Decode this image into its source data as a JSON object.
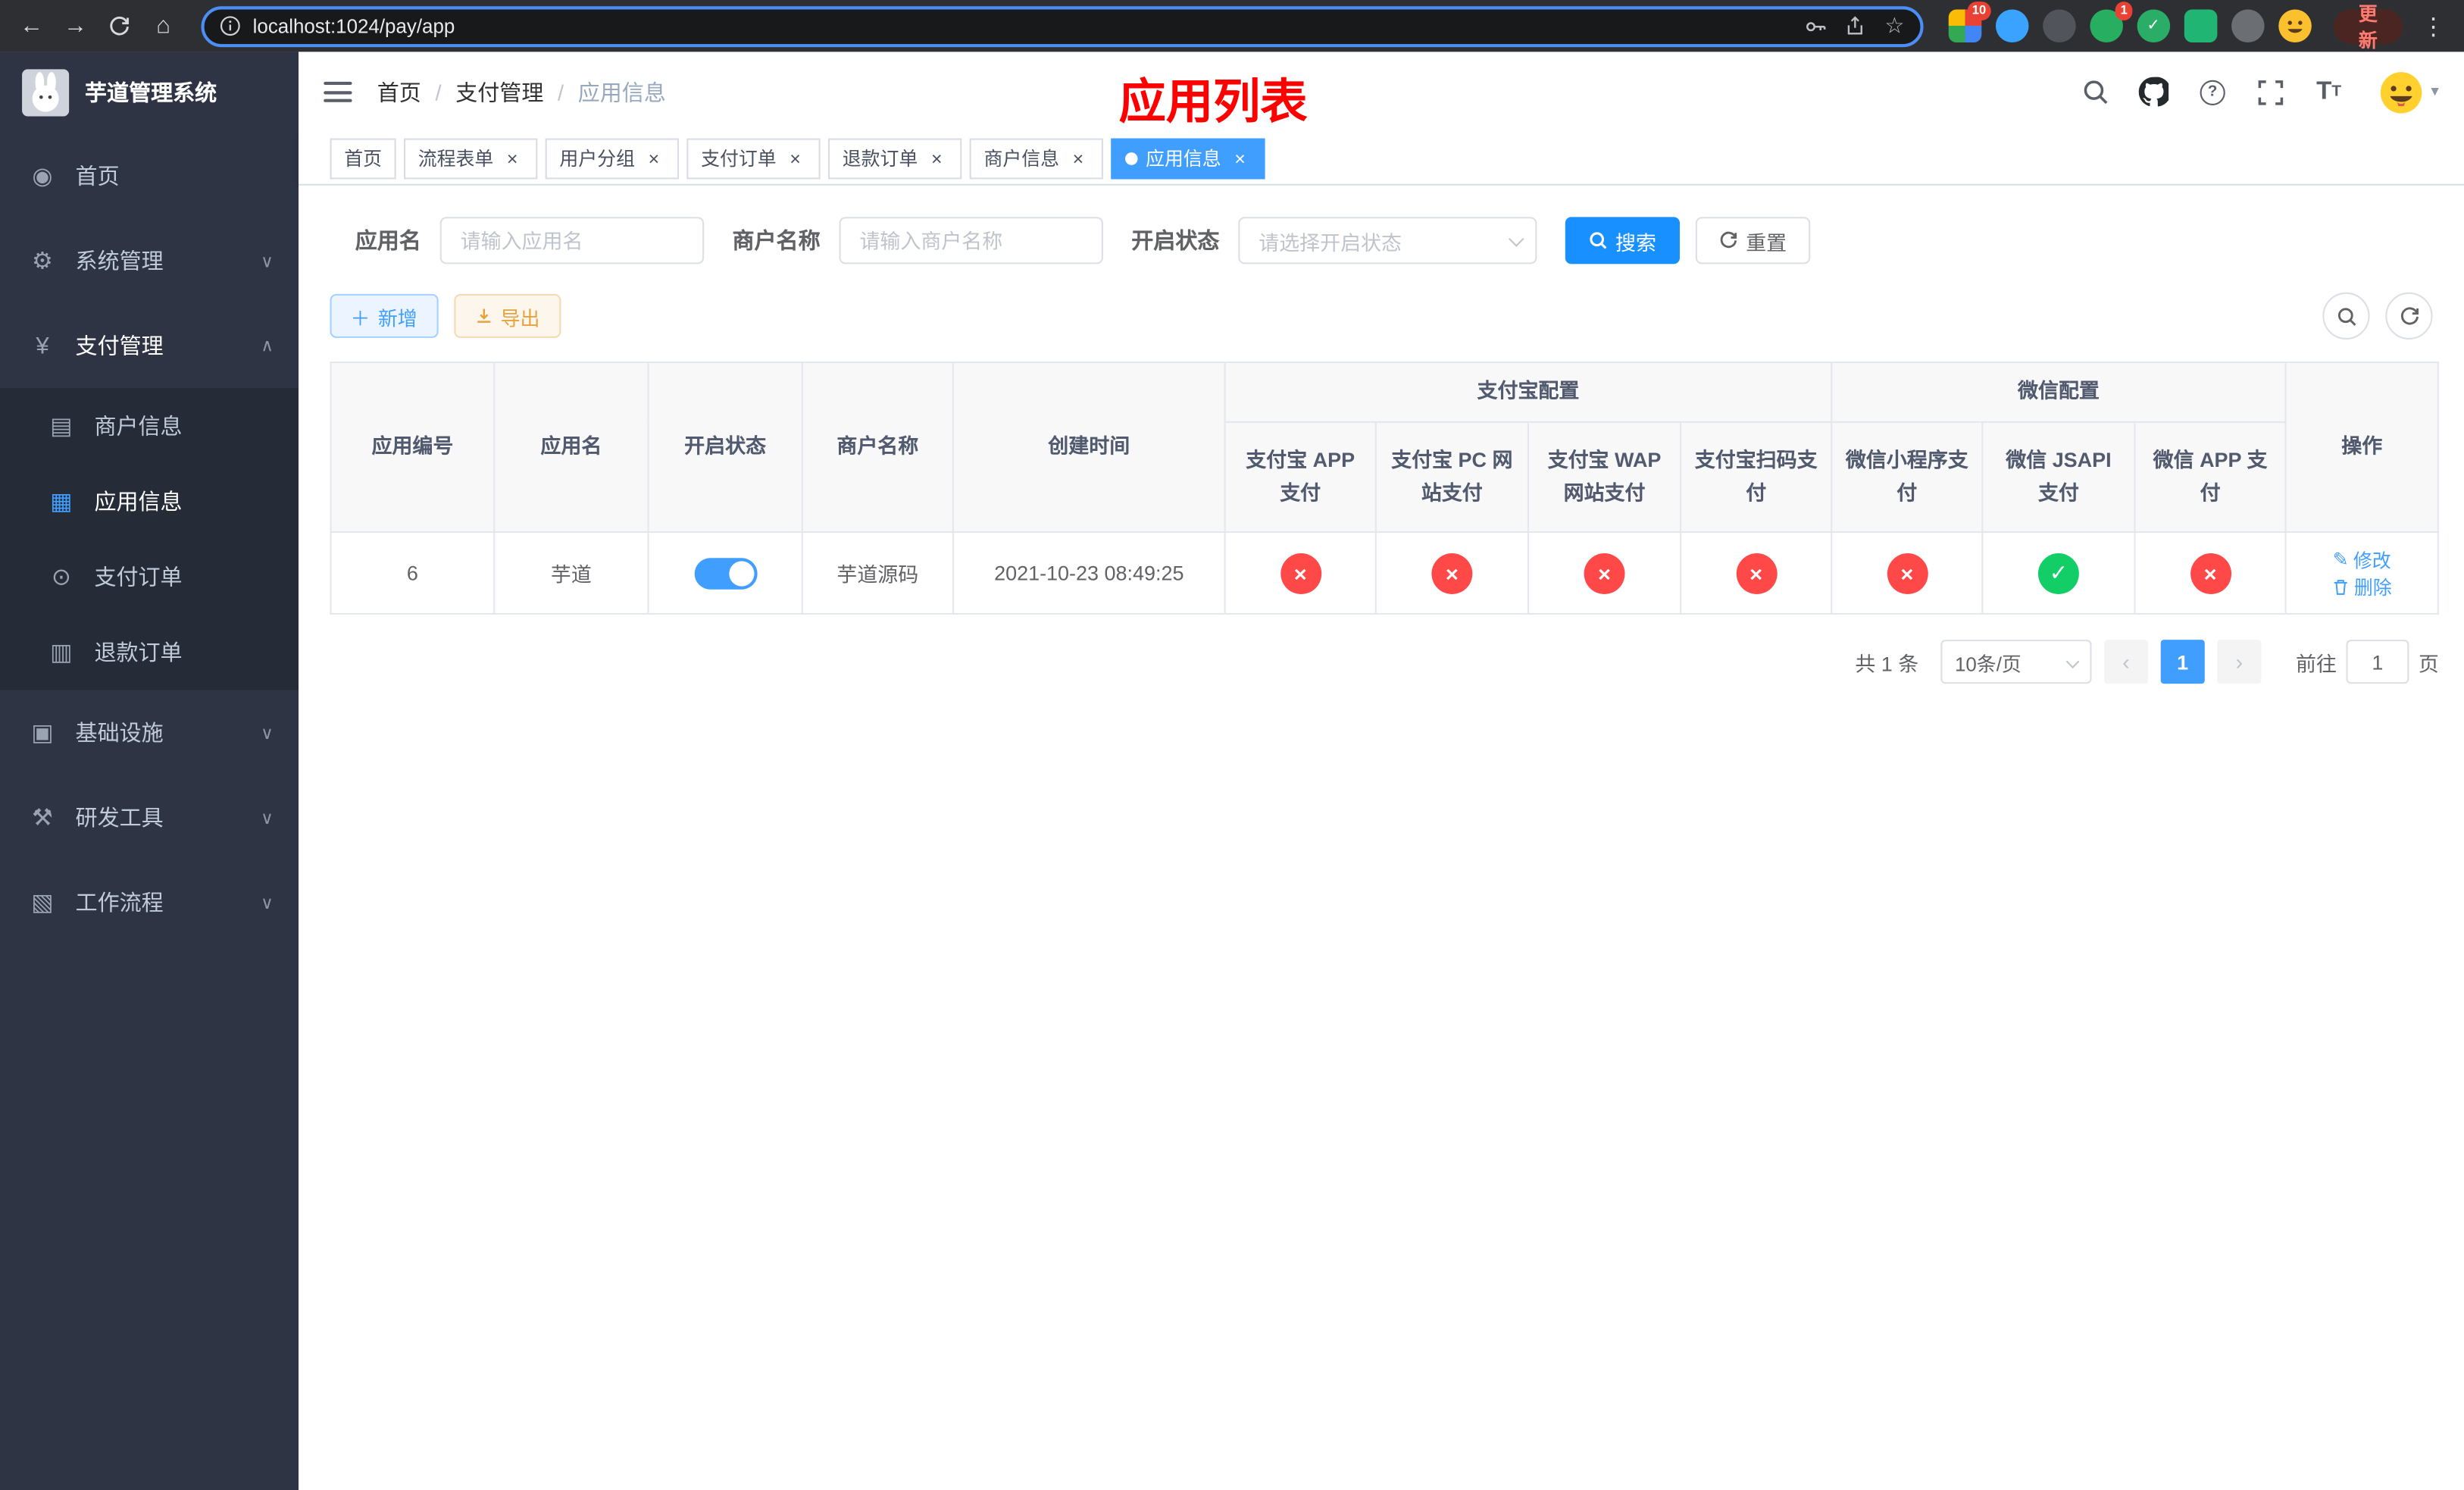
{
  "colors": {
    "primary": "#409eff",
    "search_button_blue": "#1890ff",
    "success_green": "#13ce66",
    "danger_red": "#ff4949",
    "warning_orange": "#e6a23c",
    "page_title_red": "#ff0000",
    "sidebar_bg": "#2f3444",
    "sidebar_submenu_bg": "#262b38"
  },
  "icons": {
    "dashboard": "◉",
    "system": "⚙",
    "payment": "¥",
    "merchant": "▤",
    "app": "▦",
    "pay_order": "⊙",
    "refund_order": "▥",
    "infrastructure": "▣",
    "dev_tools": "⚒",
    "workflow": "▧",
    "chevron_down": "∨",
    "close": "×",
    "check": "✓",
    "cross": "×",
    "plus": "＋",
    "prev": "‹",
    "next": "›",
    "star": "☆",
    "back": "←",
    "forward": "→",
    "home": "⌂",
    "kebab": "⋮",
    "caret_down": "▾",
    "edit": "✎"
  },
  "browser": {
    "url": "localhost:1024/pay/app",
    "update_button": "更新",
    "ext_badge_grid": "10",
    "ext_badge_green": "1"
  },
  "sidebar": {
    "logo_title": "芋道管理系统",
    "items": [
      {
        "label": "首页"
      },
      {
        "label": "系统管理"
      },
      {
        "label": "支付管理",
        "children": [
          {
            "label": "商户信息"
          },
          {
            "label": "应用信息",
            "active": true
          },
          {
            "label": "支付订单"
          },
          {
            "label": "退款订单"
          }
        ]
      },
      {
        "label": "基础设施"
      },
      {
        "label": "研发工具"
      },
      {
        "label": "工作流程"
      }
    ]
  },
  "navbar": {
    "breadcrumb": [
      "首页",
      "支付管理",
      "应用信息"
    ],
    "page_title": "应用列表"
  },
  "tags_view": [
    {
      "label": "首页",
      "closable": false,
      "active": false
    },
    {
      "label": "流程表单",
      "closable": true,
      "active": false
    },
    {
      "label": "用户分组",
      "closable": true,
      "active": false
    },
    {
      "label": "支付订单",
      "closable": true,
      "active": false
    },
    {
      "label": "退款订单",
      "closable": true,
      "active": false
    },
    {
      "label": "商户信息",
      "closable": true,
      "active": false
    },
    {
      "label": "应用信息",
      "closable": true,
      "active": true
    }
  ],
  "filters": {
    "app_name_label": "应用名",
    "app_name_placeholder": "请输入应用名",
    "merchant_name_label": "商户名称",
    "merchant_name_placeholder": "请输入商户名称",
    "status_label": "开启状态",
    "status_placeholder": "请选择开启状态",
    "search_button": "搜索",
    "reset_button": "重置"
  },
  "toolbar": {
    "add_button": "新增",
    "export_button": "导出"
  },
  "table": {
    "headers": {
      "app_id": "应用编号",
      "app_name": "应用名",
      "status": "开启状态",
      "merchant_name": "商户名称",
      "create_time": "创建时间",
      "alipay_group": "支付宝配置",
      "wechat_group": "微信配置",
      "alipay_app": "支付宝 APP 支付",
      "alipay_pc": "支付宝 PC 网站支付",
      "alipay_wap": "支付宝 WAP 网站支付",
      "alipay_qr": "支付宝扫码支付",
      "wechat_mini": "微信小程序支付",
      "wechat_jsapi": "微信 JSAPI 支付",
      "wechat_app": "微信 APP 支付",
      "actions": "操作"
    },
    "rows": [
      {
        "app_id": "6",
        "app_name": "芋道",
        "status_enabled": true,
        "merchant_name": "芋道源码",
        "create_time": "2021-10-23 08:49:25",
        "alipay_app": false,
        "alipay_pc": false,
        "alipay_wap": false,
        "alipay_qr": false,
        "wechat_mini": false,
        "wechat_jsapi": true,
        "wechat_app": false,
        "edit_label": "修改",
        "delete_label": "删除"
      }
    ]
  },
  "pagination": {
    "total_text": "共 1 条",
    "page_size": "10条/页",
    "current_page": "1",
    "goto_label": "前往",
    "goto_value": "1",
    "goto_unit": "页"
  }
}
